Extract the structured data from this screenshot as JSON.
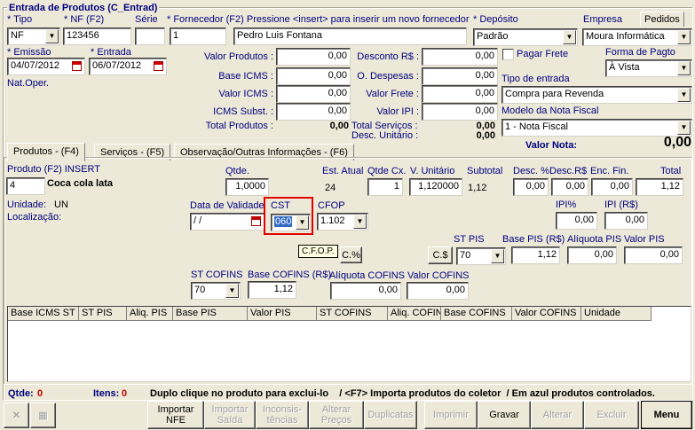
{
  "window_title": "Entrada de Produtos (C_Entrad)",
  "header": {
    "tipo_label": "* Tipo",
    "tipo_value": "NF",
    "nf_label": "* NF (F2)",
    "nf_value": "123456",
    "serie_label": "Série",
    "serie_value": "",
    "fornecedor_label": "* Fornecedor (F2) Pressione <insert> para inserir um novo fornecedor",
    "fornecedor_code": "1",
    "fornecedor_name": "Pedro Luis Fontana",
    "deposito_label": "* Depósito",
    "deposito_value": "Padrão",
    "empresa_label": "Empresa",
    "empresa_value": "Moura Informática",
    "pedidos_button": "Pedidos",
    "emissao_label": "* Emissão",
    "emissao_value": "04/07/2012",
    "entrada_label": "* Entrada",
    "entrada_value": "06/07/2012",
    "natoper_label": "Nat.Oper.",
    "pagar_frete_label": "Pagar Frete",
    "forma_pagto_label": "Forma de Pagto",
    "forma_pagto_value": "À Vista",
    "tipo_entrada_label": "Tipo de entrada",
    "tipo_entrada_value": "Compra para Revenda",
    "modelo_nf_label": "Modelo da Nota Fiscal",
    "modelo_nf_value": "1 - Nota Fiscal",
    "valor_nota_label": "Valor Nota:",
    "valor_nota_value": "0,00"
  },
  "totals": {
    "valor_produtos_label": "Valor Produtos :",
    "valor_produtos": "0,00",
    "base_icms_label": "Base ICMS :",
    "base_icms": "0,00",
    "valor_icms_label": "Valor ICMS :",
    "valor_icms": "0,00",
    "icms_subst_label": "ICMS Subst. :",
    "icms_subst": "0,00",
    "total_produtos_label": "Total Produtos :",
    "total_produtos": "0,00",
    "desconto_label": "Desconto R$ :",
    "desconto": "0,00",
    "o_despesas_label": "O. Despesas :",
    "o_despesas": "0,00",
    "valor_frete_label": "Valor Frete :",
    "valor_frete": "0,00",
    "valor_ipi_label": "Valor IPI :",
    "valor_ipi": "0,00",
    "total_servicos_label": "Total Serviços :",
    "total_servicos": "0,00",
    "desc_unitario_label": "Desc. Unitário :",
    "desc_unitario": "0,00"
  },
  "tabs": [
    {
      "label": "Produtos  - (F4)"
    },
    {
      "label": "Serviços  - (F5)"
    },
    {
      "label": "Observação/Outras Informações - (F6)"
    }
  ],
  "product": {
    "produto_label": "Produto (F2)  INSERT",
    "produto_code": "4",
    "produto_name": "Coca cola lata",
    "qtde_label": "Qtde.",
    "qtde": "1,0000",
    "est_atual_label": "Est. Atual",
    "est_atual": "24",
    "qtde_cx_label": "Qtde Cx.",
    "qtde_cx": "1",
    "v_unitario_label": "V. Unitário",
    "v_unitario": "1,120000",
    "subtotal_label": "Subtotal",
    "subtotal": "1,12",
    "desc_pct_label": "Desc. %",
    "desc_pct": "0,00",
    "desc_rs_label": "Desc.R$",
    "desc_rs": "0,00",
    "enc_fin_label": "Enc. Fin.",
    "enc_fin": "0,00",
    "total_label": "Total",
    "total": "1,12",
    "unidade_label": "Unidade:",
    "unidade": "UN",
    "localizacao_label": "Localização:",
    "validade_label": "Data de Validade",
    "validade": " / /",
    "cst_label": "CST",
    "cst": "060",
    "cfop_label": "CFOP",
    "cfop": "1.102",
    "cfop_tooltip": "C.F.O.P.",
    "c_pct_button": "C.%",
    "ipi_pct_label": "IPI%",
    "ipi_pct": "0,00",
    "ipi_rs_label": "IPI (R$)",
    "ipi_rs": "0,00",
    "st_pis_label": "ST PIS",
    "st_pis": "70",
    "c_dollar_button": "C.$",
    "base_pis_label": "Base PIS (R$)",
    "base_pis": "1,12",
    "aliquota_pis_label": "Alíquota PIS",
    "aliquota_pis": "0,00",
    "valor_pis_label": "Valor PIS",
    "valor_pis": "0,00",
    "st_cofins_label": "ST COFINS",
    "st_cofins": "70",
    "base_cofins_label": "Base COFINS (R$)",
    "base_cofins": "1,12",
    "aliquota_cofins_label": "Alíquota COFINS",
    "aliquota_cofins": "0,00",
    "valor_cofins_label": "Valor COFINS",
    "valor_cofins": "0,00"
  },
  "grid_columns": [
    "Base ICMS ST",
    "ST PIS",
    "Aliq. PIS",
    "Base PIS",
    "Valor PIS",
    "ST COFINS",
    "Aliq. COFIN",
    "Base COFINS",
    "Valor COFINS",
    "Unidade"
  ],
  "status": {
    "qtde_label": "Qtde:",
    "qtde_value": "0",
    "itens_label": "Itens:",
    "itens_value": "0",
    "hint": "Duplo clique no produto para exclui-lo    / <F7> Importa produtos do coletor  / Em azul produtos controlados."
  },
  "toolbar": {
    "importar_nfe": "Importar NFE",
    "importar_saida": "Importar Saída",
    "inconsistencias": "Inconsis- tências",
    "alterar_precos": "Alterar Preços",
    "duplicatas": "Duplicatas",
    "imprimir": "Imprimir",
    "gravar": "Gravar",
    "alterar": "Alterar",
    "excluir": "Excluir",
    "menu": "Menu"
  },
  "colors": {
    "background": "#ece9d8",
    "label_navy": "#000080",
    "status_red": "#c00000",
    "highlight_red": "#e00000",
    "selection": "#316ac5"
  }
}
